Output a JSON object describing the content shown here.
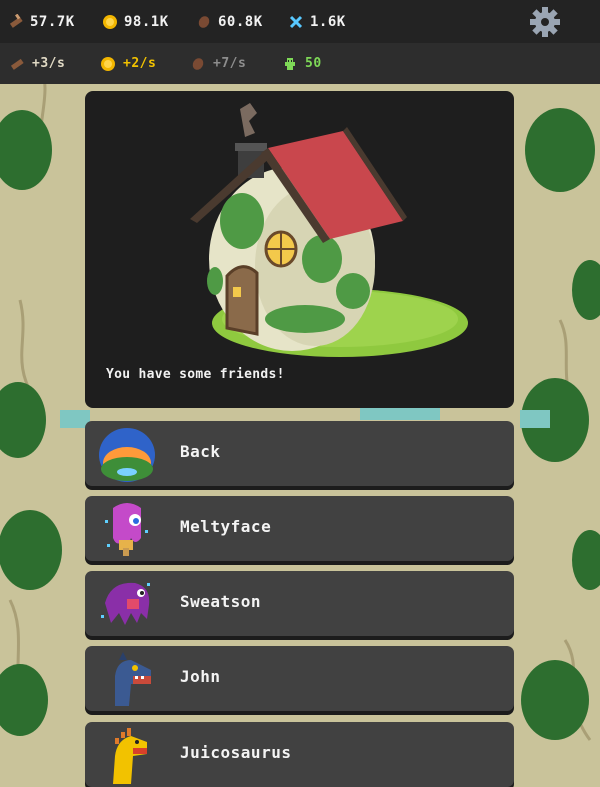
{
  "resources": {
    "wood": "57.7K",
    "gold": "98.1K",
    "meat": "60.8K",
    "crystal": "1.6K"
  },
  "rates": {
    "wood": "+3/s",
    "gold": "+2/s",
    "meat": "+7/s",
    "population": "50"
  },
  "colors": {
    "wood_rate": "#e8e8e8",
    "gold_rate": "#f2c200",
    "meat_rate": "#8a8a8a",
    "population_rate": "#7ed957"
  },
  "panel": {
    "message": "You have some friends!"
  },
  "friends": [
    {
      "name": "Back",
      "icon": "landscape-icon"
    },
    {
      "name": "Meltyface",
      "icon": "meltyface-avatar-icon"
    },
    {
      "name": "Sweatson",
      "icon": "sweatson-avatar-icon"
    },
    {
      "name": "John",
      "icon": "john-avatar-icon"
    },
    {
      "name": "Juicosaurus",
      "icon": "juicosaurus-avatar-icon"
    }
  ]
}
